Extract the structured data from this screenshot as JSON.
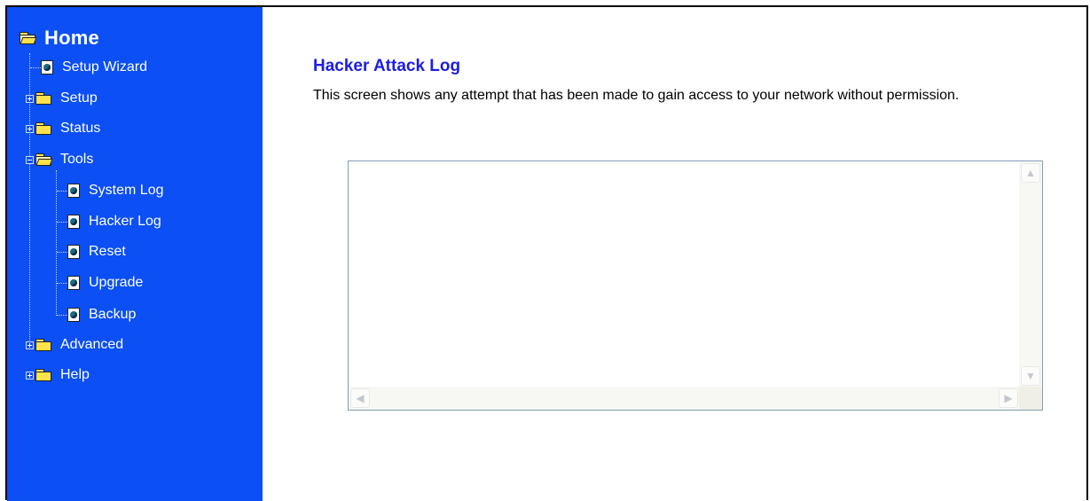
{
  "sidebar": {
    "home": "Home",
    "items": [
      {
        "label": "Setup Wizard"
      },
      {
        "label": "Setup"
      },
      {
        "label": "Status"
      },
      {
        "label": "Tools"
      },
      {
        "label": "System Log"
      },
      {
        "label": "Hacker Log"
      },
      {
        "label": "Reset"
      },
      {
        "label": "Upgrade"
      },
      {
        "label": "Backup"
      },
      {
        "label": "Advanced"
      },
      {
        "label": "Help"
      }
    ]
  },
  "main": {
    "title": "Hacker Attack Log",
    "description": "This screen shows any attempt that has been made to gain access to your network without permission.",
    "log_content": ""
  },
  "colors": {
    "sidebar_bg": "#0b4ff5",
    "title": "#1d1de0"
  }
}
